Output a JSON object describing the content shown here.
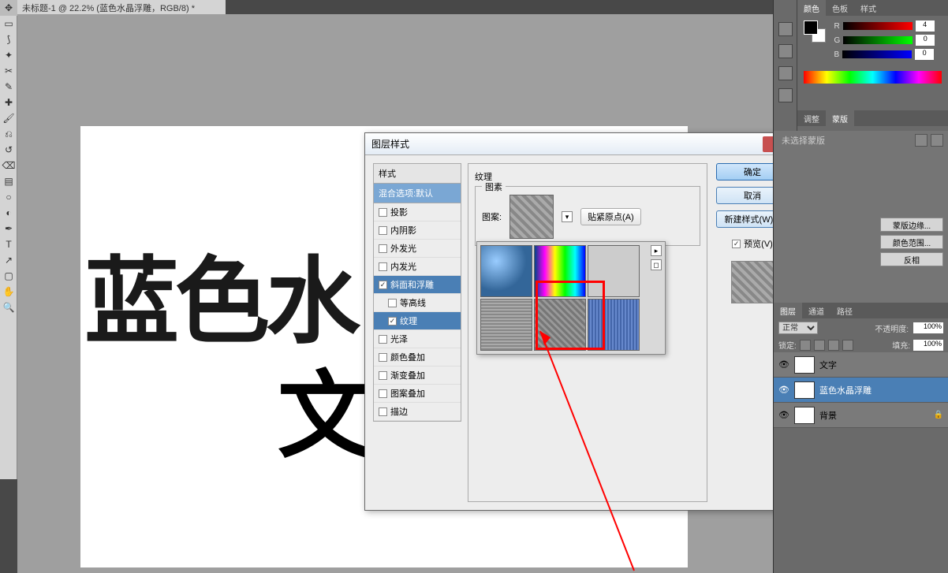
{
  "doc_tab": "未标题-1 @ 22.2% (蓝色水晶浮雕，RGB/8) *",
  "canvas": {
    "line1": "蓝色水",
    "line2": "文"
  },
  "dialog": {
    "title": "图层样式",
    "styles_header": "样式",
    "blend_options": "混合选项:默认",
    "items": [
      {
        "label": "投影",
        "checked": false
      },
      {
        "label": "内阴影",
        "checked": false
      },
      {
        "label": "外发光",
        "checked": false
      },
      {
        "label": "内发光",
        "checked": false
      },
      {
        "label": "斜面和浮雕",
        "checked": true,
        "selected": true
      },
      {
        "label": "等高线",
        "checked": false,
        "sub": true
      },
      {
        "label": "纹理",
        "checked": true,
        "sub": true,
        "selected": true
      },
      {
        "label": "光泽",
        "checked": false
      },
      {
        "label": "颜色叠加",
        "checked": false
      },
      {
        "label": "渐变叠加",
        "checked": false
      },
      {
        "label": "图案叠加",
        "checked": false
      },
      {
        "label": "描边",
        "checked": false
      }
    ],
    "section": "纹理",
    "fieldset": "图素",
    "pattern_label": "图案:",
    "snap_btn": "贴紧原点(A)",
    "buttons": {
      "ok": "确定",
      "cancel": "取消",
      "new_style": "新建样式(W)..."
    },
    "preview_chk": "预览(V)"
  },
  "color_panel": {
    "tabs": [
      "颜色",
      "色板",
      "样式"
    ],
    "r": "4",
    "g": "0",
    "b": "0"
  },
  "adj_tabs": [
    "调整",
    "蒙版"
  ],
  "mask_panel": {
    "title": "未选择蒙版",
    "btns": [
      "蒙版边缘...",
      "颜色范围...",
      "反相"
    ]
  },
  "layers_panel": {
    "tabs": [
      "图层",
      "通道",
      "路径"
    ],
    "mode": "正常",
    "opacity_label": "不透明度:",
    "opacity": "100%",
    "lock_label": "锁定:",
    "fill_label": "填充:",
    "fill": "100%",
    "layers": [
      {
        "name": "文字",
        "active": false
      },
      {
        "name": "蓝色水晶浮雕",
        "active": true
      },
      {
        "name": "背景",
        "active": false,
        "locked": true
      }
    ]
  }
}
